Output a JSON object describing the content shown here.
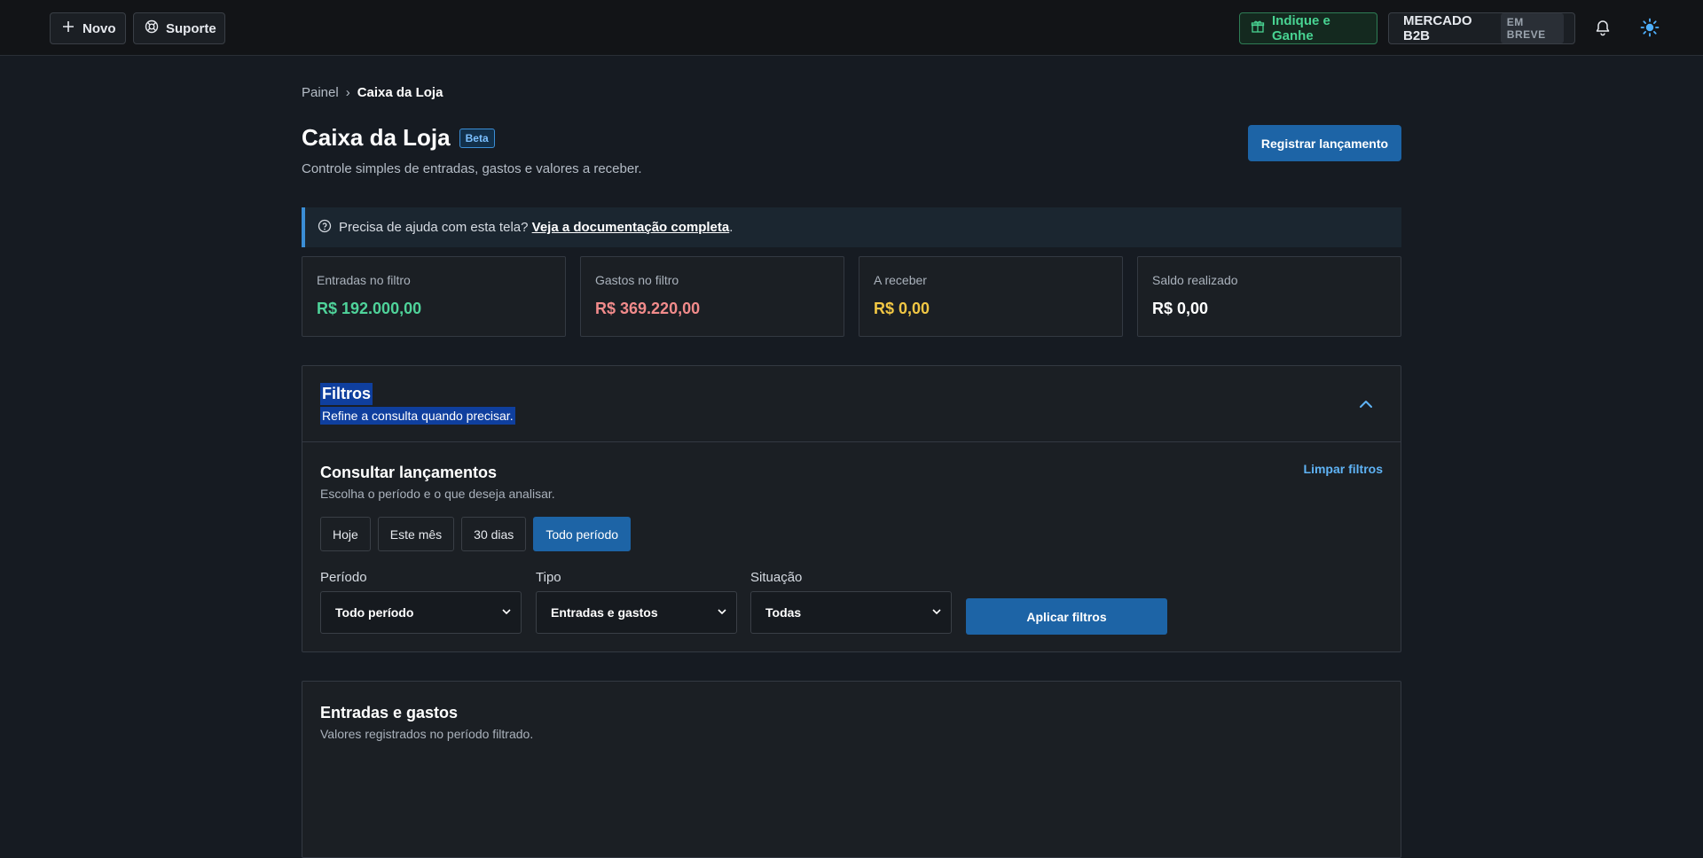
{
  "topbar": {
    "novo_label": "Novo",
    "suporte_label": "Suporte",
    "indique_label": "Indique e Ganhe",
    "mercado_label": "MERCADO B2B",
    "mercado_badge": "EM BREVE"
  },
  "breadcrumb": {
    "root": "Painel",
    "separator": "›",
    "current": "Caixa da Loja"
  },
  "header": {
    "title": "Caixa da Loja",
    "badge": "Beta",
    "subtitle": "Controle simples de entradas, gastos e valores a receber.",
    "primary_action": "Registrar lançamento"
  },
  "help": {
    "text": "Precisa de ajuda com esta tela?",
    "link": "Veja a documentação completa",
    "trail": "."
  },
  "cards": [
    {
      "label": "Entradas no filtro",
      "value": "R$ 192.000,00",
      "color": "#4fd39a"
    },
    {
      "label": "Gastos no filtro",
      "value": "R$ 369.220,00",
      "color": "#f28b8b"
    },
    {
      "label": "A receber",
      "value": "R$ 0,00",
      "color": "#f2c744"
    },
    {
      "label": "Saldo realizado",
      "value": "R$ 0,00",
      "color": "#ffffff"
    }
  ],
  "filters": {
    "title": "Filtros",
    "subtitle": "Refine a consulta quando precisar.",
    "body_title": "Consultar lançamentos",
    "body_subtitle": "Escolha o período e o que deseja analisar.",
    "clear_label": "Limpar filtros",
    "pills": [
      "Hoje",
      "Este mês",
      "30 dias",
      "Todo período"
    ],
    "active_pill": "Todo período",
    "fields": [
      {
        "label": "Período",
        "value": "Todo período"
      },
      {
        "label": "Tipo",
        "value": "Entradas e gastos"
      },
      {
        "label": "Situação",
        "value": "Todas"
      }
    ],
    "apply_label": "Aplicar filtros"
  },
  "entries": {
    "title": "Entradas e gastos",
    "subtitle": "Valores registrados no período filtrado."
  },
  "colors": {
    "accent": "#1d64a6",
    "link": "#5fb3f5",
    "success": "#48d392"
  }
}
